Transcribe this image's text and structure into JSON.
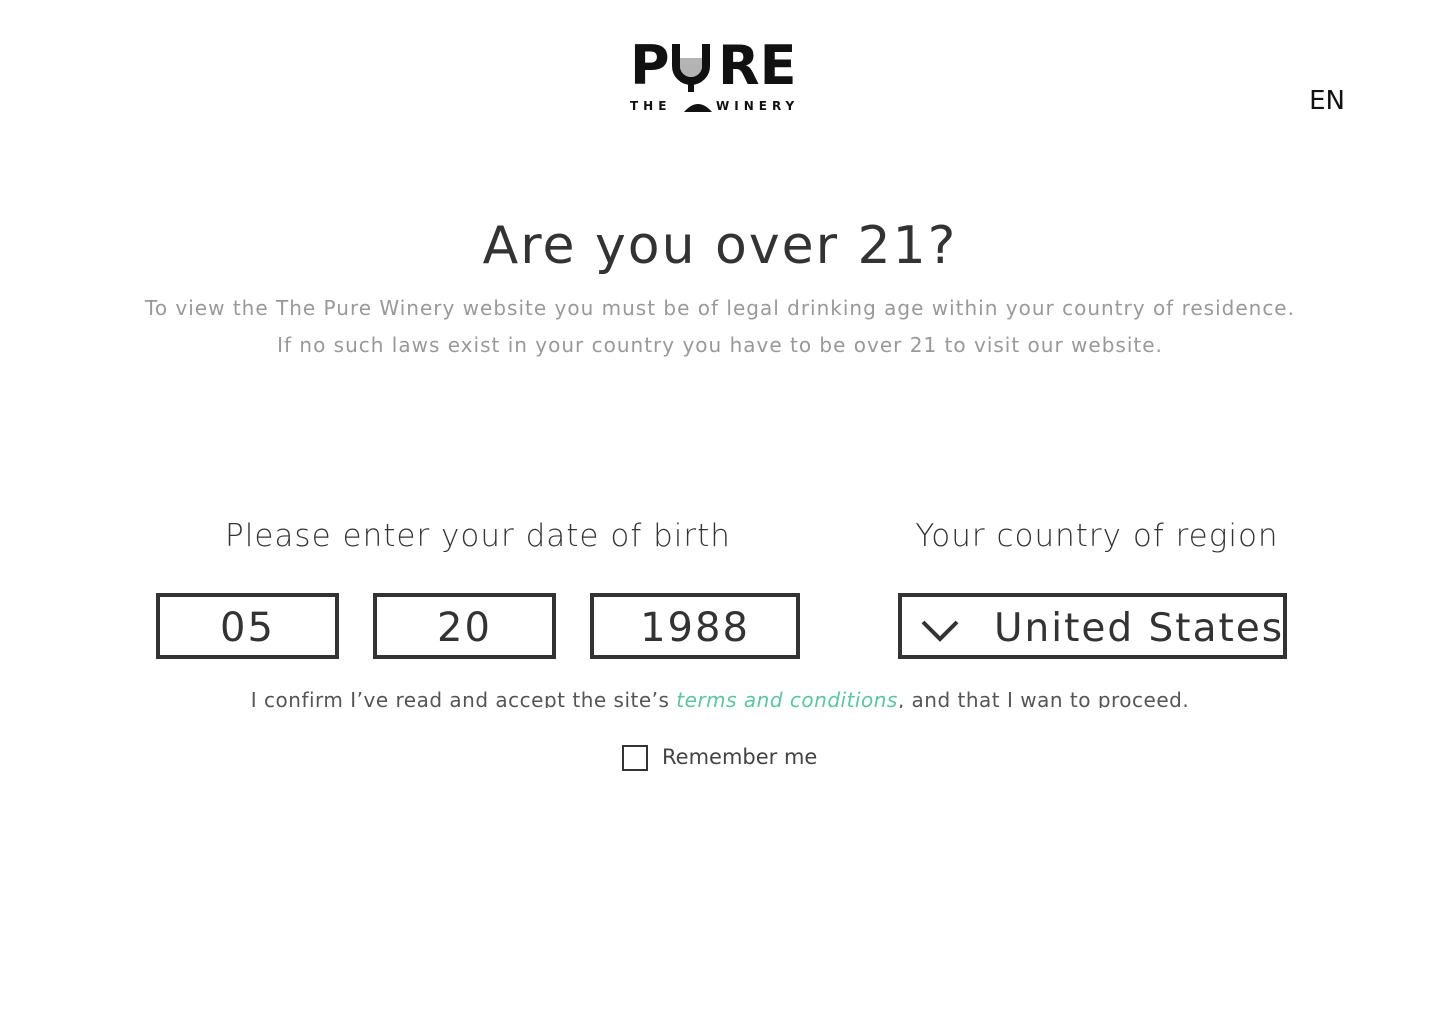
{
  "brand": {
    "wordmark_left": "P",
    "wordmark_right": "RE",
    "tagline_left": "THE",
    "tagline_right": "WINERY"
  },
  "header": {
    "language": "EN"
  },
  "hero": {
    "title": "Are you over 21?",
    "description_line1": "To view the The Pure Winery website you must be of legal drinking age within your country of residence.",
    "description_line2": "If no such laws exist in your country you have to be over 21 to visit our website."
  },
  "dob": {
    "label": "Please enter your date of birth",
    "month": "05",
    "day": "20",
    "year": "1988"
  },
  "country": {
    "label": "Your country of region",
    "selected": "United States",
    "icon": "chevron-down-icon"
  },
  "confirm": {
    "prefix": "I confirm I’ve read and accept the site’s ",
    "link_text": "terms and conditions",
    "suffix": ", and that I wan to proceed."
  },
  "remember": {
    "label": "Remember me",
    "checked": false
  },
  "colors": {
    "text": "#333333",
    "muted": "#999999",
    "accent": "#5cc4a3",
    "glass": "#b3b3b3"
  }
}
